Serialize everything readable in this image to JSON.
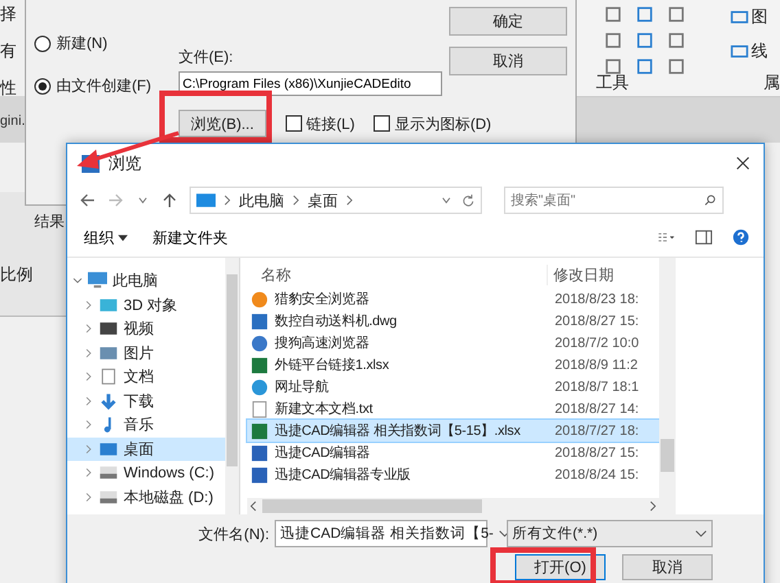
{
  "background_app": {
    "left_labels": [
      "择",
      "有",
      "性"
    ],
    "tab_label": "gini.",
    "ribbon_groups": [
      "工具",
      "属"
    ],
    "ribbon_items": [
      "图",
      "线"
    ],
    "panel_labels": [
      "结果",
      "比例"
    ]
  },
  "insert_dialog": {
    "radios": [
      {
        "label": "新建(N)",
        "selected": false
      },
      {
        "label": "由文件创建(F)",
        "selected": true
      }
    ],
    "file_label": "文件(E):",
    "file_value": "C:\\Program Files (x86)\\XunjieCADEdito",
    "browse_button": "浏览(B)...",
    "checkboxes": [
      {
        "label": "链接(L)",
        "checked": false
      },
      {
        "label": "显示为图标(D)",
        "checked": false
      }
    ],
    "buttons": [
      "确定",
      "取消"
    ]
  },
  "browse_dialog": {
    "title": "浏览",
    "path": [
      "此电脑",
      "桌面"
    ],
    "search": {
      "placeholder": "搜索\"桌面\""
    },
    "organize": "组织",
    "new_folder": "新建文件夹",
    "nav": [
      {
        "label": "此电脑",
        "kind": "pc",
        "expanded": true,
        "selected": false,
        "children": [
          {
            "label": "3D 对象",
            "kind": "cube",
            "selected": false
          },
          {
            "label": "视频",
            "kind": "video",
            "selected": false
          },
          {
            "label": "图片",
            "kind": "picture",
            "selected": false
          },
          {
            "label": "文档",
            "kind": "doc",
            "selected": false
          },
          {
            "label": "下载",
            "kind": "download",
            "selected": false
          },
          {
            "label": "音乐",
            "kind": "music",
            "selected": false
          },
          {
            "label": "桌面",
            "kind": "desktop",
            "selected": true
          },
          {
            "label": "Windows (C:)",
            "kind": "drive",
            "selected": false
          },
          {
            "label": "本地磁盘 (D:)",
            "kind": "drive",
            "selected": false
          }
        ]
      }
    ],
    "columns": [
      "名称",
      "修改日期"
    ],
    "files": [
      {
        "name": "猎豹安全浏览器",
        "date": "2018/8/23 18:",
        "kind": "browser",
        "selected": false
      },
      {
        "name": "数控自动送料机.dwg",
        "date": "2018/8/27 15:",
        "kind": "cad",
        "selected": false
      },
      {
        "name": "搜狗高速浏览器",
        "date": "2018/7/2 10:0",
        "kind": "browser2",
        "selected": false
      },
      {
        "name": "外链平台链接1.xlsx",
        "date": "2018/8/9 11:2",
        "kind": "excel",
        "selected": false
      },
      {
        "name": "网址导航",
        "date": "2018/8/7 18:1",
        "kind": "ie",
        "selected": false
      },
      {
        "name": "新建文本文档.txt",
        "date": "2018/8/27 14:",
        "kind": "text",
        "selected": false
      },
      {
        "name": "迅捷CAD编辑器 相关指数词【5-15】.xlsx",
        "date": "2018/7/27 18:",
        "kind": "excel",
        "selected": true
      },
      {
        "name": "迅捷CAD编辑器",
        "date": "2018/8/27 15:",
        "kind": "app",
        "selected": false
      },
      {
        "name": "迅捷CAD编辑器专业版",
        "date": "2018/8/24 15:",
        "kind": "app",
        "selected": false
      }
    ],
    "filename_label": "文件名(N):",
    "filename_value": "迅捷CAD编辑器 相关指数词【5-",
    "filter": "所有文件(*.*)",
    "buttons": [
      "打开(O)",
      "取消"
    ]
  }
}
